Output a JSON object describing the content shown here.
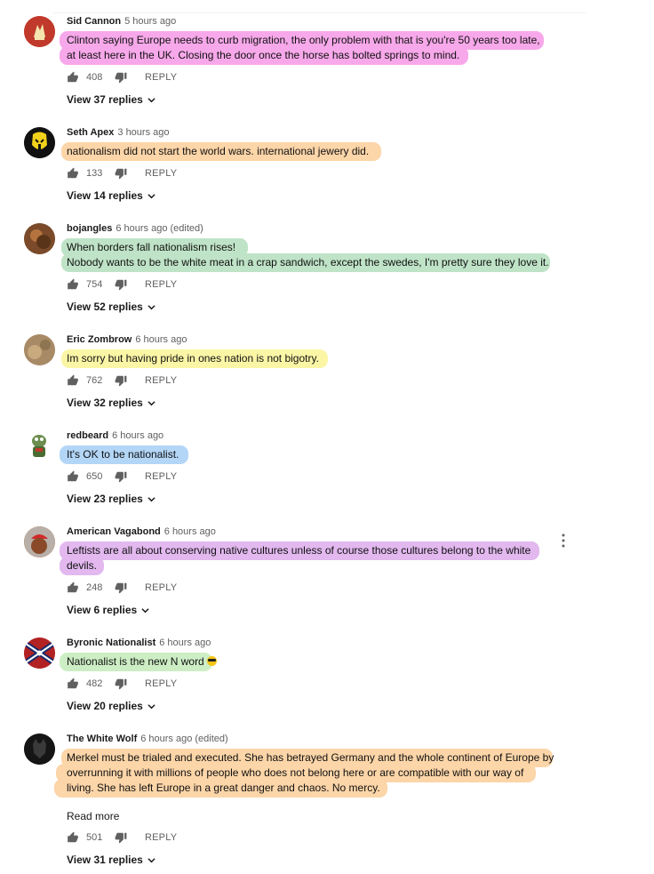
{
  "comments": [
    {
      "author": "Sid Cannon",
      "time": "5 hours ago",
      "lines": [
        "Clinton saying Europe needs to curb migration, the only problem with that is you're 50 years too late,",
        "at least here in the UK.  Closing the door once the horse has bolted springs to mind."
      ],
      "highlight": "#f7a8ea",
      "likes": "408",
      "reply_label": "REPLY",
      "view_replies": "View 37 replies",
      "avatar_color": "#c0392b",
      "avatar_icon": "crest-icon"
    },
    {
      "author": "Seth Apex",
      "time": "3 hours ago",
      "lines": [
        "nationalism did not start the world wars. international jewery did."
      ],
      "highlight": "#fcd5a8",
      "likes": "133",
      "reply_label": "REPLY",
      "view_replies": "View 14 replies",
      "avatar_color": "#111111",
      "avatar_icon": "mask-icon"
    },
    {
      "author": "bojangles",
      "time": "6 hours ago (edited)",
      "lines": [
        "When borders fall nationalism rises!",
        "Nobody wants to be the white meat in a crap sandwich, except the swedes, I'm pretty sure they love it."
      ],
      "highlight": "#bfe3c7",
      "likes": "754",
      "reply_label": "REPLY",
      "view_replies": "View 52 replies",
      "avatar_color": "#8a5a3a",
      "avatar_icon": "photo-icon"
    },
    {
      "author": "Eric Zombrow",
      "time": "6 hours ago",
      "lines": [
        "Im sorry but having pride in ones nation is not bigotry."
      ],
      "highlight": "#fbf6a6",
      "likes": "762",
      "reply_label": "REPLY",
      "view_replies": "View 32 replies",
      "avatar_color": "#b09070",
      "avatar_icon": "photo-icon"
    },
    {
      "author": "redbeard",
      "time": "6 hours ago",
      "lines": [
        "It's OK to be nationalist."
      ],
      "highlight": "#b3d6f7",
      "likes": "650",
      "reply_label": "REPLY",
      "view_replies": "View 23 replies",
      "avatar_color": "#ffffff",
      "avatar_icon": "frog-icon"
    },
    {
      "author": "American Vagabond",
      "time": "6 hours ago",
      "lines": [
        "Leftists are all about conserving native cultures unless of course those cultures belong to the white",
        "devils."
      ],
      "highlight": "#e2b8ef",
      "likes": "248",
      "reply_label": "REPLY",
      "view_replies": "View 6 replies",
      "avatar_color": "#a0502a",
      "avatar_icon": "photo-icon"
    },
    {
      "author": "Byronic Nationalist",
      "time": "6 hours ago",
      "lines": [
        "Nationalist is the new N word"
      ],
      "highlight": "#cdeec4",
      "likes": "482",
      "reply_label": "REPLY",
      "view_replies": "View 20 replies",
      "avatar_color": "#b22222",
      "avatar_icon": "flag-icon"
    },
    {
      "author": "The White Wolf",
      "time": "6 hours ago (edited)",
      "lines": [
        "Merkel must be trialed and executed. She has betrayed Germany and the whole continent of Europe by",
        "overrunning it with millions of people who does not belong here or are compatible with our way of",
        "living. She has left Europe in a great danger and chaos. No mercy."
      ],
      "highlight": "#fcd5a8",
      "likes": "501",
      "reply_label": "REPLY",
      "view_replies": "View 31 replies",
      "read_more": "Read more",
      "avatar_color": "#1a1a1a",
      "avatar_icon": "wolf-icon"
    }
  ]
}
